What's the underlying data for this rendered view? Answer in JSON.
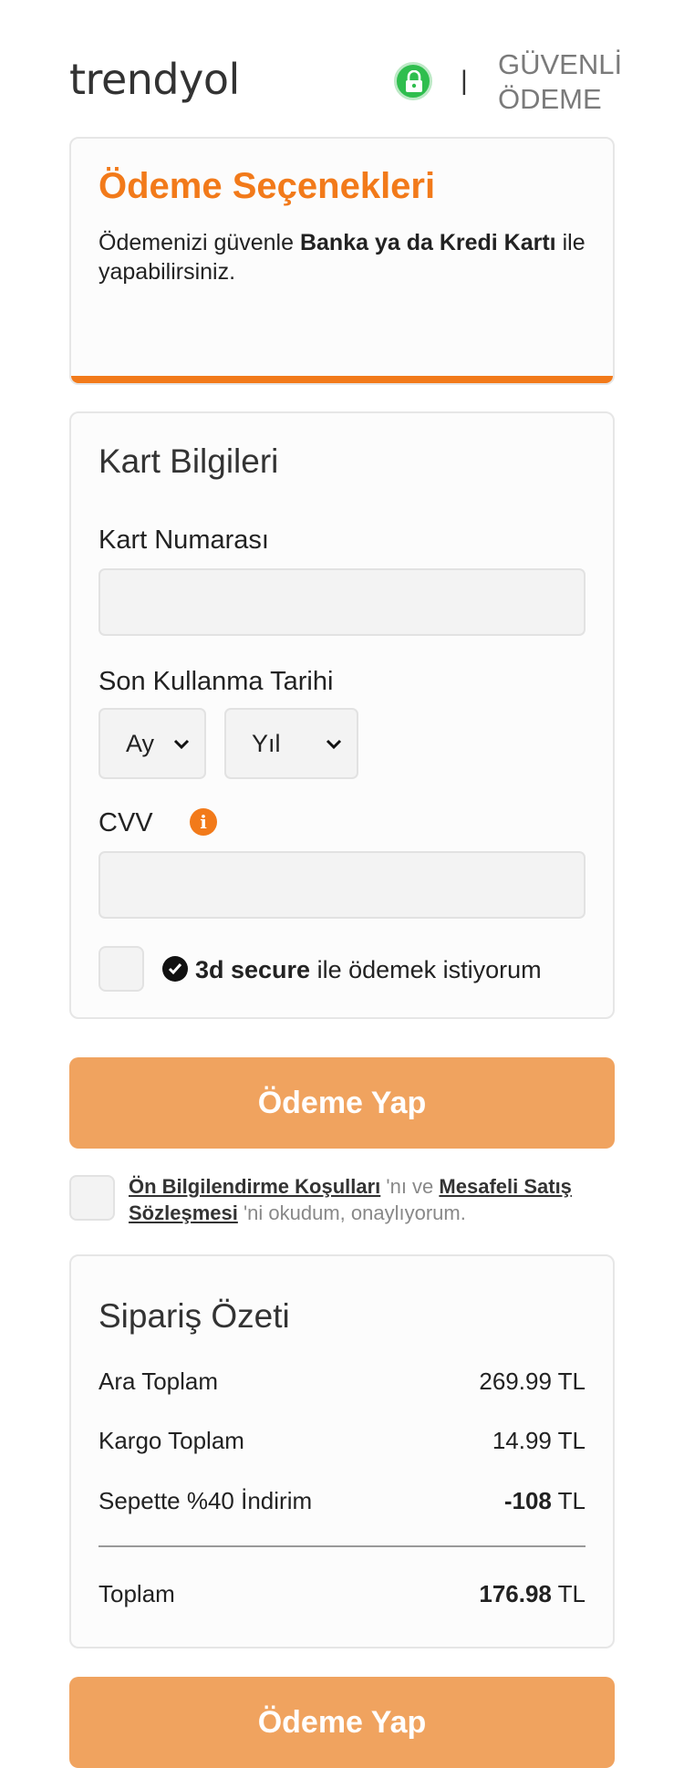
{
  "header": {
    "logo": "trendyol",
    "separator": "|",
    "secure_line1": "GÜVENLİ",
    "secure_line2": "ÖDEME",
    "lock_icon": "lock-icon"
  },
  "payment_options": {
    "title": "Ödeme Seçenekleri",
    "desc_prefix": "Ödemenizi güvenle ",
    "desc_bold": "Banka ya da Kredi Kartı",
    "desc_suffix": " ile yapabilirsiniz."
  },
  "card_info": {
    "title": "Kart Bilgileri",
    "card_number_label": "Kart Numarası",
    "card_number_value": "",
    "expiry_label": "Son Kullanma Tarihi",
    "month_value": "Ay",
    "year_value": "Yıl",
    "cvv_label": "CVV",
    "cvv_info": "i",
    "cvv_value": "",
    "secure_bold": "3d secure",
    "secure_rest": " ile ödemek istiyorum",
    "secure_checked": false
  },
  "pay_button_label": "Ödeme Yap",
  "agreement": {
    "link1": "Ön Bilgilendirme Koşulları",
    "mid": " 'nı ve ",
    "link2": "Mesafeli Satış Sözleşmesi",
    "suffix": " 'ni okudum, onaylıyorum.",
    "checked": false
  },
  "summary": {
    "title": "Sipariş Özeti",
    "subtotal_label": "Ara Toplam",
    "subtotal_value": "269.99 TL",
    "shipping_label": "Kargo Toplam",
    "shipping_value": "14.99 TL",
    "discount_label": "Sepette %40 İndirim",
    "discount_amount": "-108",
    "total_label": "Toplam",
    "total_amount": "176.98",
    "currency": " TL"
  },
  "colors": {
    "brand_orange": "#f27a1a",
    "button_orange": "#f0a35f",
    "lock_green": "#2fbe4e"
  }
}
